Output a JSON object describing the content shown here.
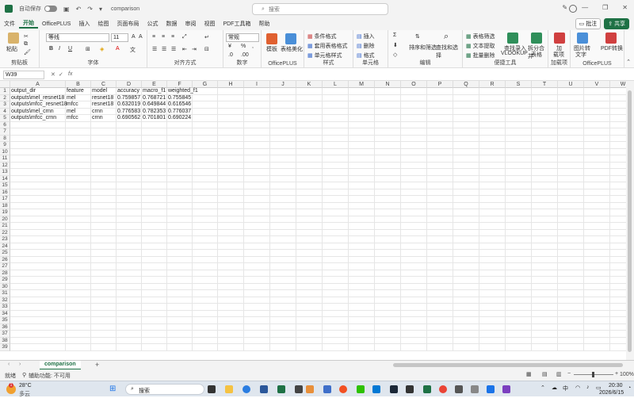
{
  "titlebar": {
    "autosave": "自动保存",
    "filename": "comparison",
    "search": "搜索"
  },
  "menu": {
    "tabs": [
      "文件",
      "开始",
      "OfficePLUS",
      "插入",
      "绘图",
      "页面布局",
      "公式",
      "数据",
      "审阅",
      "视图",
      "PDF工具箱",
      "帮助"
    ],
    "comments": "批注",
    "share": "共享"
  },
  "ribbon": {
    "clipboard": {
      "paste": "粘贴",
      "label": "剪贴板"
    },
    "font": {
      "name": "等线",
      "size": "11",
      "label": "字体"
    },
    "align": {
      "label": "对齐方式"
    },
    "number": {
      "format": "常规",
      "label": "数字"
    },
    "officeplus": {
      "templates": "模板",
      "beautify": "表格美化",
      "label": "OfficePLUS"
    },
    "styles": {
      "conditional": "条件格式",
      "table": "套用表格格式",
      "cell": "单元格样式",
      "label": "样式"
    },
    "cells": {
      "insert": "插入",
      "delete": "删除",
      "format": "格式",
      "label": "单元格"
    },
    "editing": {
      "sort": "排序和筛选",
      "find": "查找和选择",
      "label": "编辑"
    },
    "tools": {
      "filter": "表格筛选",
      "text": "文本提取",
      "batch": "批量删除",
      "lookup1": "查找录入",
      "lookup2": "VLOOKUP",
      "split1": "拆分合并",
      "split2": "表格",
      "label": "便捷工具"
    },
    "addins": {
      "add1": "加",
      "add2": "载项",
      "label": "加载项"
    },
    "op2": {
      "img1": "图片转",
      "img2": "文字",
      "pdf1": "PDF转换",
      "pdf2": "",
      "label": "OfficePLUS"
    }
  },
  "formula": {
    "namebox": "W39",
    "fx": "fx"
  },
  "columns": [
    "A",
    "B",
    "C",
    "D",
    "E",
    "F",
    "G",
    "H",
    "I",
    "J",
    "K",
    "L",
    "M",
    "N",
    "O",
    "P",
    "Q",
    "R",
    "S",
    "T",
    "U",
    "V",
    "W"
  ],
  "rows": [
    "1",
    "2",
    "3",
    "4",
    "5",
    "6",
    "7",
    "8",
    "9",
    "10",
    "11",
    "12",
    "13",
    "14",
    "15",
    "16",
    "17",
    "18",
    "19",
    "20",
    "21",
    "22",
    "23",
    "24",
    "25",
    "26",
    "27",
    "28",
    "29",
    "30",
    "31",
    "32",
    "33",
    "34",
    "35",
    "36",
    "37",
    "38",
    "39"
  ],
  "table": {
    "header": [
      "output_dir",
      "feature",
      "model",
      "accuracy",
      "macro_f1",
      "weighted_f1"
    ],
    "data": [
      [
        "outputs\\mel_resnet18",
        "mel",
        "resnet18",
        "0.759857",
        "0.768721",
        "0.755845"
      ],
      [
        "outputs\\mfcc_resnet18",
        "mfcc",
        "resnet18",
        "0.632019",
        "0.649844",
        "0.616546"
      ],
      [
        "outputs\\mel_crnn",
        "mel",
        "crnn",
        "0.776583",
        "0.782353",
        "0.776037"
      ],
      [
        "outputs\\mfcc_crnn",
        "mfcc",
        "crnn",
        "0.690562",
        "0.701801",
        "0.690224"
      ]
    ]
  },
  "sheet": {
    "tab": "comparison",
    "add": "+"
  },
  "status": {
    "ready": "就绪",
    "accessibility": "辅助功能: 不可用",
    "zoom": "100%"
  },
  "taskbar": {
    "temp": "28°C",
    "weather": "多云",
    "search": "搜索",
    "time": "20:30",
    "date": "2026/6/15",
    "badge": "1"
  }
}
